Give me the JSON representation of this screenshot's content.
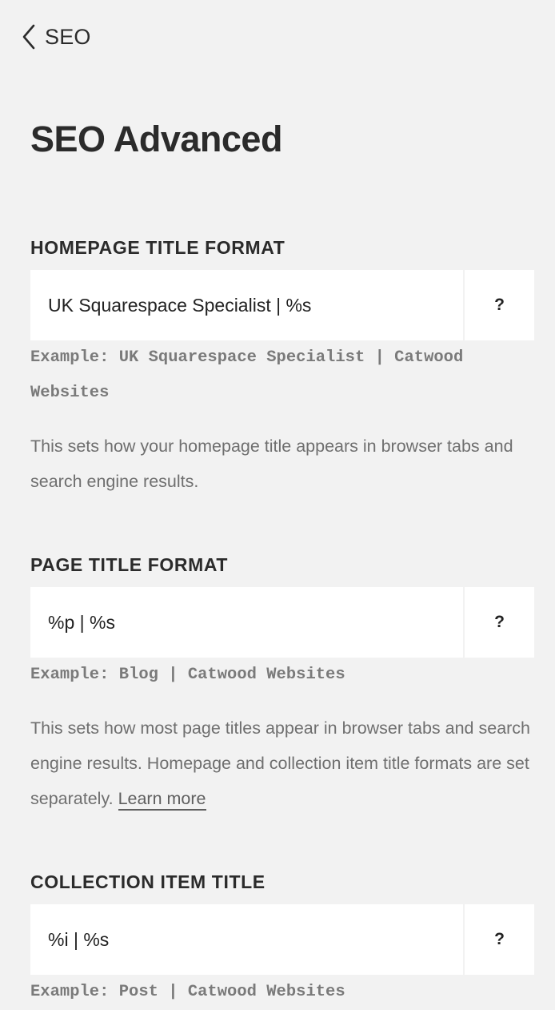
{
  "nav": {
    "back_label": "SEO"
  },
  "page": {
    "title": "SEO Advanced"
  },
  "sections": [
    {
      "label": "HOMEPAGE TITLE FORMAT",
      "value": "UK Squarespace Specialist | %s",
      "help": "?",
      "example": "Example: UK Squarespace Specialist | Catwood Websites",
      "description": "This sets how your homepage title appears in browser tabs and search engine results."
    },
    {
      "label": "PAGE TITLE FORMAT",
      "value": "%p | %s",
      "help": "?",
      "example": "Example: Blog | Catwood Websites",
      "description": "This sets how most page titles appear in browser tabs and search engine results. Homepage and collection item title formats are set separately.",
      "link": "Learn more"
    },
    {
      "label": "COLLECTION ITEM TITLE",
      "value": "%i | %s",
      "help": "?",
      "example": "Example: Post | Catwood Websites"
    }
  ]
}
